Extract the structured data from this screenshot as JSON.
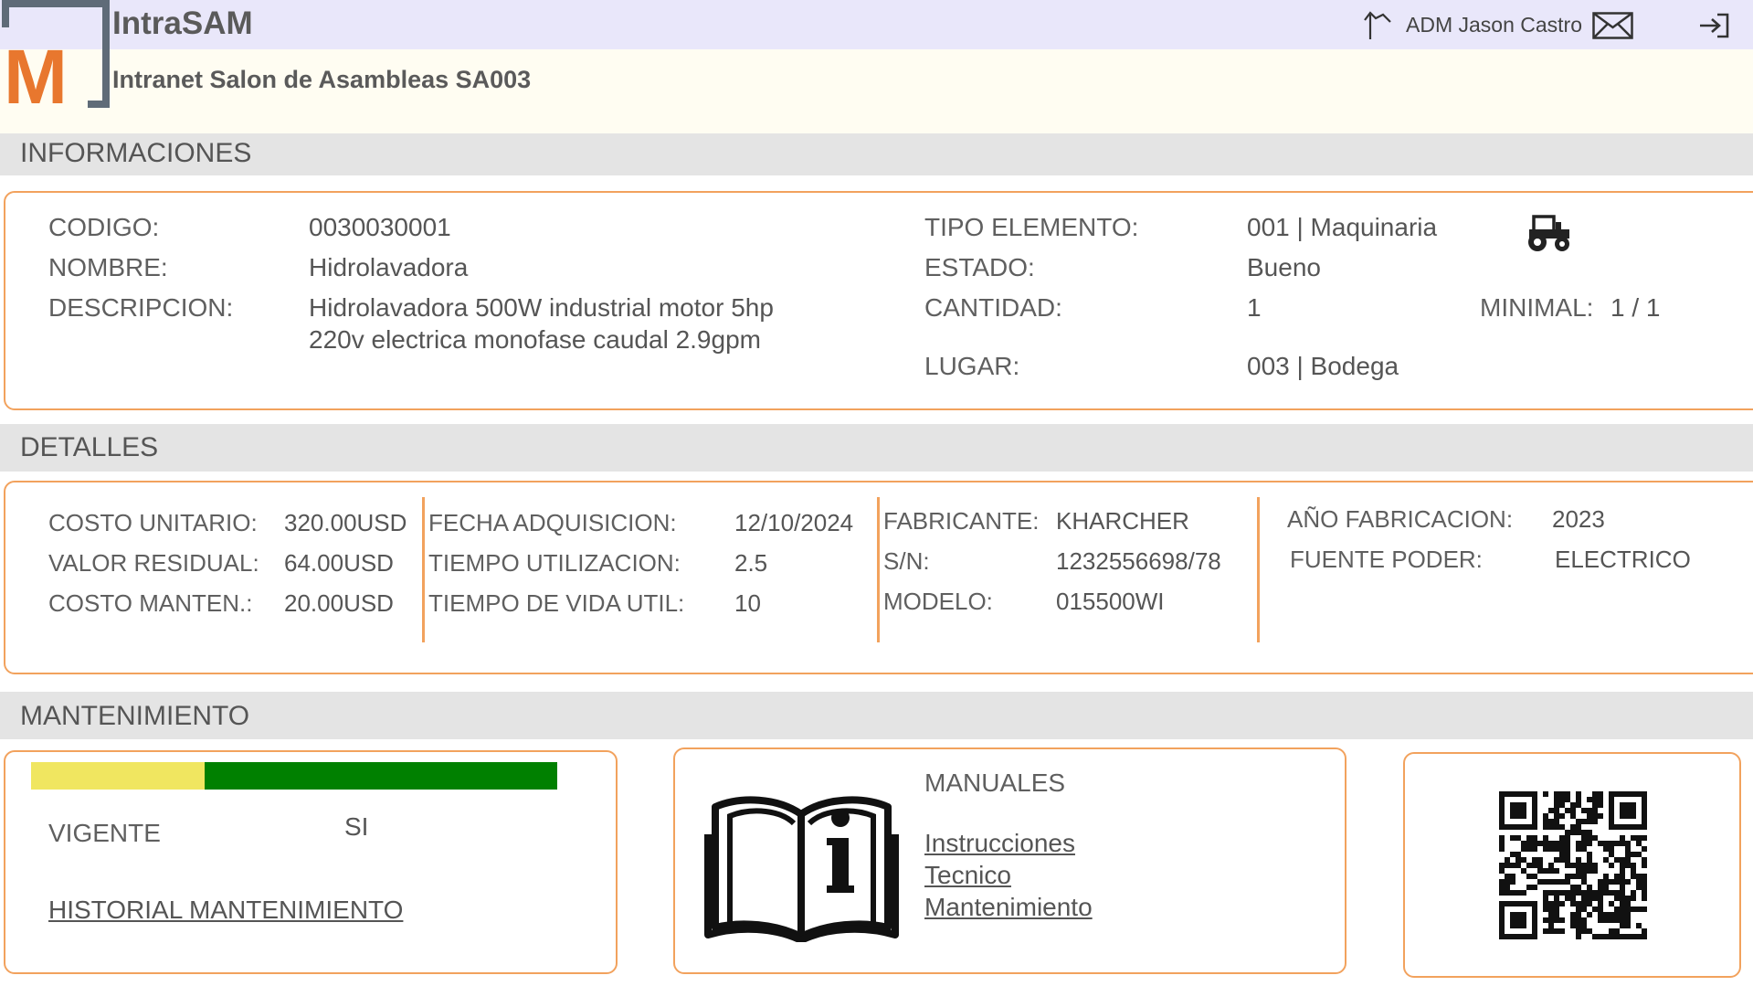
{
  "header": {
    "app_title": "IntraSAM",
    "app_subtitle": "Intranet Salon de Asambleas SA003",
    "logo_letter": "M",
    "user_label": "ADM Jason Castro",
    "icons": [
      "home-arrow-icon",
      "mail-icon",
      "logout-icon"
    ]
  },
  "sections": {
    "info": "INFORMACIONES",
    "details": "DETALLES",
    "maintenance": "MANTENIMIENTO"
  },
  "info": {
    "codigo_label": "CODIGO:",
    "codigo_value": "0030030001",
    "nombre_label": "NOMBRE:",
    "nombre_value": "Hidrolavadora",
    "descripcion_label": "DESCRIPCION:",
    "descripcion_line1": "Hidrolavadora 500W industrial motor 5hp",
    "descripcion_line2": "220v electrica monofase caudal 2.9gpm",
    "tipo_label": "TIPO ELEMENTO:",
    "tipo_value": "001 | Maquinaria",
    "tipo_icon": "tractor-icon",
    "estado_label": "ESTADO:",
    "estado_value": "Bueno",
    "cantidad_label": "CANTIDAD:",
    "cantidad_value": "1",
    "minimal_label": "MINIMAL:",
    "minimal_value": "1 / 1",
    "lugar_label": "LUGAR:",
    "lugar_value": "003 | Bodega"
  },
  "details": {
    "costo_unitario_label": "COSTO UNITARIO:",
    "costo_unitario_value": "320.00USD",
    "valor_residual_label": "VALOR RESIDUAL:",
    "valor_residual_value": "64.00USD",
    "costo_manten_label": "COSTO MANTEN.:",
    "costo_manten_value": "20.00USD",
    "fecha_adq_label": "FECHA ADQUISICION:",
    "fecha_adq_value": "12/10/2024",
    "tiempo_util_label": "TIEMPO UTILIZACION:",
    "tiempo_util_value": "2.5",
    "vida_util_label": "TIEMPO DE VIDA UTIL:",
    "vida_util_value": "10",
    "fabricante_label": "FABRICANTE:",
    "fabricante_value": "KHARCHER",
    "sn_label": "S/N:",
    "sn_value": "1232556698/78",
    "modelo_label": "MODELO:",
    "modelo_value": "015500WI",
    "anio_label": "AÑO FABRICACION:",
    "anio_value": "2023",
    "fuente_label": "FUENTE PODER:",
    "fuente_value": "ELECTRICO"
  },
  "maintenance": {
    "progress_fraction": 0.33,
    "colors": {
      "elapsed": "#f0e660",
      "remaining": "#008000",
      "accent": "#f2a25d"
    },
    "vigente_label": "VIGENTE",
    "vigente_value": "SI",
    "historial_link": "HISTORIAL MANTENIMIENTO",
    "manuales_title": "MANUALES",
    "manual_icon": "manual-info-icon",
    "manual_links": [
      "Instrucciones",
      "Tecnico",
      "Mantenimiento"
    ],
    "qr_icon": "qr-code-icon"
  }
}
